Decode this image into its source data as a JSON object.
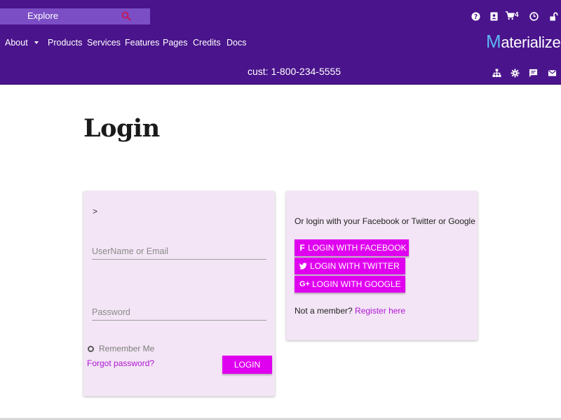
{
  "search": {
    "label": "Explore"
  },
  "nav": {
    "items": [
      "About",
      "Products",
      "Services",
      "Features",
      "Pages",
      "Credits",
      "Docs"
    ]
  },
  "header": {
    "cart_count": "4",
    "phone": "cust: 1-800-234-5555"
  },
  "brand": {
    "first_letter": "M",
    "rest": "aterialized"
  },
  "page": {
    "title": "Login"
  },
  "login_form": {
    "prompt": ">",
    "username_placeholder": "UserName or Email",
    "password_placeholder": "Password",
    "remember_label": "Remember Me",
    "forgot_label": "Forgot password?",
    "submit_label": "LOGIN"
  },
  "social": {
    "intro": "Or login with your Facebook or Twitter or Google",
    "facebook_label": "LOGIN WITH FACEBOOK",
    "twitter_label": "LOGIN WITH TWITTER",
    "google_label": "LOGIN WITH GOOGLE",
    "google_icon_text": "G+",
    "facebook_icon_text": "f",
    "not_member": "Not a member?",
    "register_label": "Register here"
  },
  "colors": {
    "header_bg": "#4a148c",
    "search_bg": "#7b4ec5",
    "card_bg": "#f3e5f5",
    "accent_button": "#e000f0",
    "link": "#b015d4",
    "brand_m": "#5cb6f2"
  },
  "icons": {
    "top": [
      "help-icon",
      "contact-icon",
      "cart-icon",
      "clock-icon",
      "lock-open-icon"
    ],
    "bottom": [
      "sitemap-icon",
      "settings-icon",
      "comment-icon",
      "mail-icon"
    ]
  }
}
